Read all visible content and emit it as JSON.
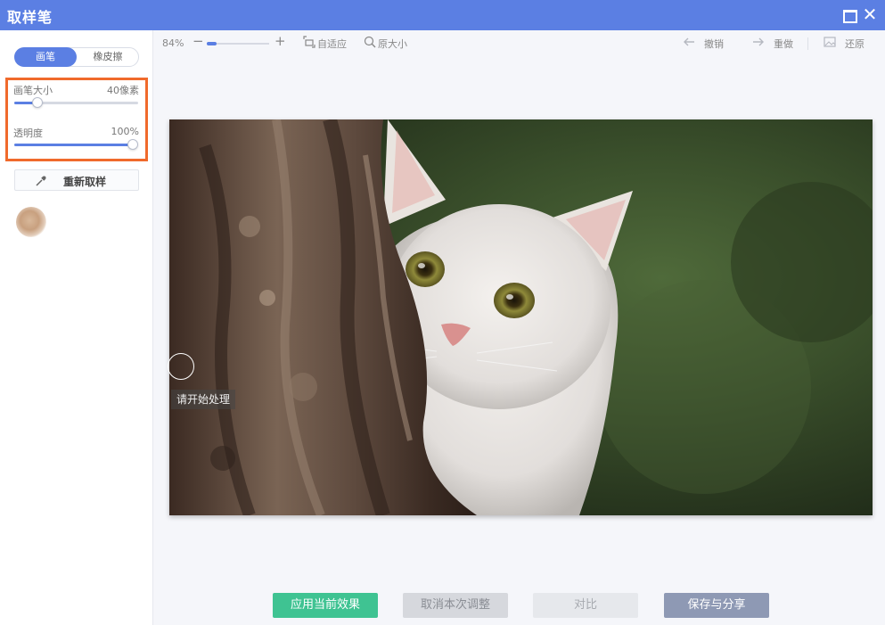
{
  "window": {
    "title": "取样笔"
  },
  "sidebar": {
    "mode_toggle": {
      "brush_label": "画笔",
      "eraser_label": "橡皮擦",
      "active": "brush"
    },
    "brush_size": {
      "label": "画笔大小",
      "value_text": "40像素",
      "level_fraction": 0.19
    },
    "opacity": {
      "label": "透明度",
      "value_text": "100%",
      "level_fraction": 0.96
    },
    "resample_button": {
      "label": "重新取样"
    },
    "sample_color": "#c8a07f"
  },
  "toolbar": {
    "zoom_text": "84%",
    "zoom_level_fraction": 0.15,
    "fit_label": "自适应",
    "original_size_label": "原大小",
    "undo_label": "撤销",
    "redo_label": "重做",
    "restore_label": "还原"
  },
  "canvas": {
    "hint_text": "请开始处理"
  },
  "actions": {
    "apply_label": "应用当前效果",
    "cancel_label": "取消本次调整",
    "compare_label": "对比",
    "save_label": "保存与分享"
  },
  "colors": {
    "accent": "#5b7fe3",
    "highlight": "#f06a2c",
    "apply": "#3fc392",
    "save": "#8e99b4"
  }
}
